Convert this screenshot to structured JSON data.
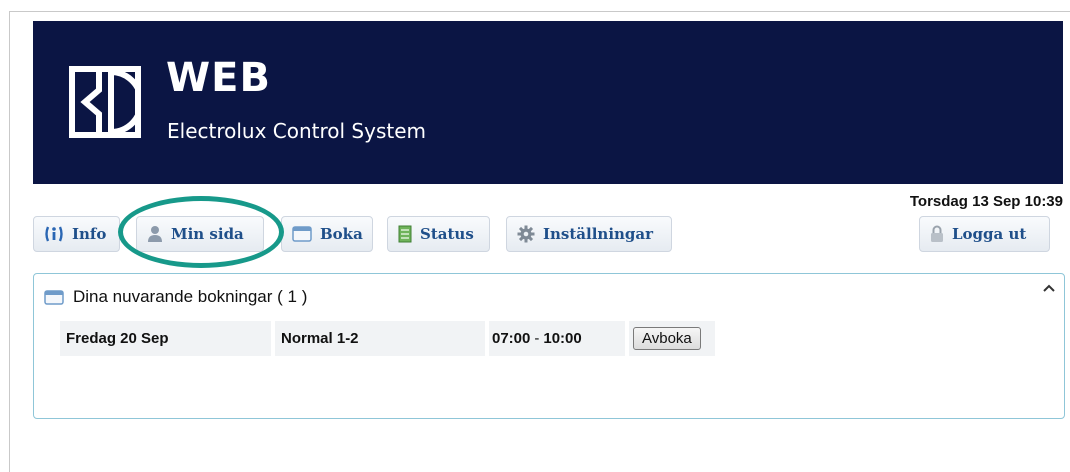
{
  "header": {
    "brand_title": "WEB",
    "brand_subtitle": "Electrolux Control System",
    "datetime": "Torsdag 13 Sep 10:39"
  },
  "nav": {
    "info": "Info",
    "min_sida": "Min sida",
    "boka": "Boka",
    "status": "Status",
    "installningar": "Inställningar",
    "logga_ut": "Logga ut"
  },
  "bookings": {
    "title": "Dina nuvarande bokningar ( 1 )",
    "rows": [
      {
        "day": "Fredag 20 Sep",
        "resource": "Normal 1-2",
        "start": "07:00",
        "sep": "-",
        "end": "10:00",
        "action": "Avboka"
      }
    ]
  },
  "colors": {
    "banner": "#0b1544",
    "highlight": "#17998a",
    "link": "#1f4f8a"
  },
  "icons": [
    "info-icon",
    "user-icon",
    "calendar-icon",
    "status-icon",
    "gear-icon",
    "lock-icon",
    "chevron-up-icon"
  ]
}
